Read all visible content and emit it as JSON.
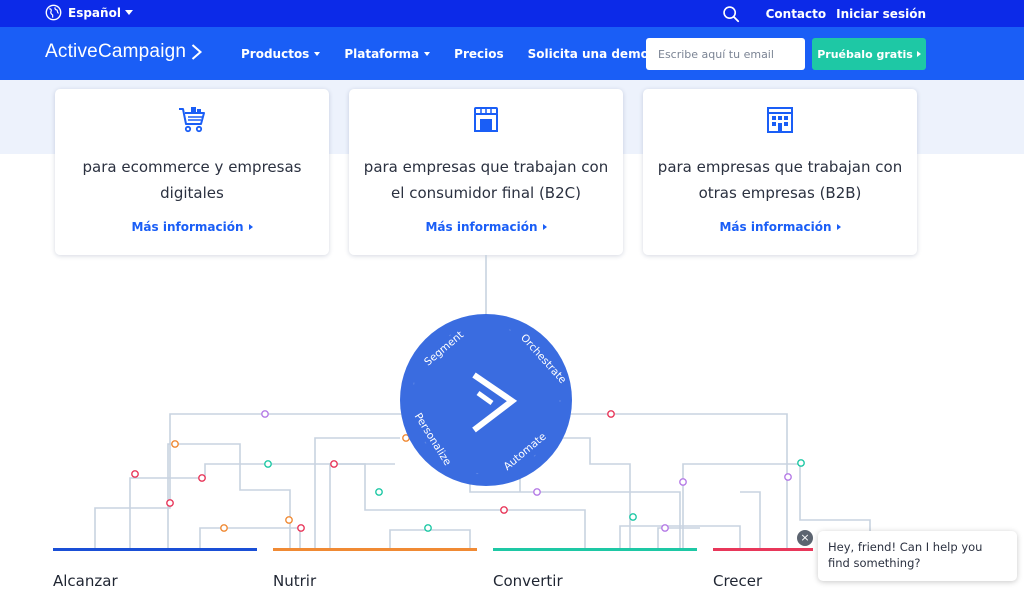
{
  "topbar": {
    "language": "Español",
    "links": [
      "Contacto",
      "Iniciar sesión"
    ],
    "icons": {
      "language": "globe-icon",
      "search": "search-icon"
    }
  },
  "navbar": {
    "logo": "ActiveCampaign",
    "items": [
      {
        "label": "Productos",
        "dropdown": true
      },
      {
        "label": "Plataforma",
        "dropdown": true
      },
      {
        "label": "Precios",
        "dropdown": false
      },
      {
        "label": "Solicita una demostración",
        "dropdown": false
      }
    ],
    "email_placeholder": "Escribe aquí tu email",
    "cta": "Pruébalo gratis"
  },
  "cards": [
    {
      "icon": "shopping-cart-icon",
      "text": "para ecommerce y empresas digitales",
      "link": "Más información"
    },
    {
      "icon": "storefront-icon",
      "text": "para empresas que trabajan con el consumidor final (B2C)",
      "link": "Más información"
    },
    {
      "icon": "office-building-icon",
      "text": "para empresas que trabajan con otras empresas (B2B)",
      "link": "Más información"
    }
  ],
  "hub": {
    "icon": "activecampaign-chevron-icon",
    "labels": [
      "Segment",
      "Orchestrate",
      "Automate",
      "Personalize"
    ]
  },
  "stages": [
    {
      "label": "Alcanzar",
      "color": "#1a4fd6"
    },
    {
      "label": "Nutrir",
      "color": "#f08a34"
    },
    {
      "label": "Convertir",
      "color": "#1ec8a5"
    },
    {
      "label": "Crecer",
      "color": "#e8375a"
    }
  ],
  "chat": {
    "message": "Hey, friend! Can I help you find something?",
    "close": "×"
  },
  "colors": {
    "topbar": "#0c2ae8",
    "navbar": "#1a5ef6",
    "cta": "#1ec8a5",
    "hub": "#3a6ce0"
  }
}
